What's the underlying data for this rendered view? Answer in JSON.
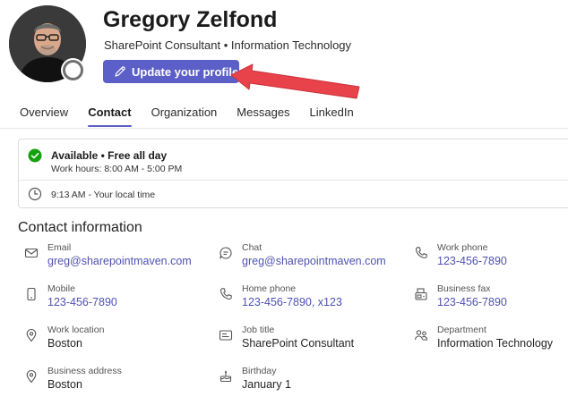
{
  "profile": {
    "name": "Gregory Zelfond",
    "subtitle": "SharePoint Consultant • Information Technology",
    "update_button": "Update your profile",
    "more": "."
  },
  "tabs": [
    {
      "label": "Overview",
      "active": false
    },
    {
      "label": "Contact",
      "active": true
    },
    {
      "label": "Organization",
      "active": false
    },
    {
      "label": "Messages",
      "active": false
    },
    {
      "label": "LinkedIn",
      "active": false
    }
  ],
  "status": {
    "title": "Available • Free all day",
    "work_hours": "Work hours: 8:00 AM - 5:00 PM",
    "local_time": "9:13 AM - Your local time"
  },
  "contact": {
    "section_title": "Contact information",
    "fields": [
      {
        "label": "Email",
        "value": "greg@sharepointmaven.com",
        "link": true,
        "icon": "mail-icon"
      },
      {
        "label": "Chat",
        "value": "greg@sharepointmaven.com",
        "link": true,
        "icon": "chat-icon"
      },
      {
        "label": "Work phone",
        "value": "123-456-7890",
        "link": true,
        "icon": "phone-icon"
      },
      {
        "label": "Mobile",
        "value": "123-456-7890",
        "link": true,
        "icon": "mobile-icon"
      },
      {
        "label": "Home phone",
        "value": "123-456-7890, x123",
        "link": true,
        "icon": "phone-icon"
      },
      {
        "label": "Business fax",
        "value": "123-456-7890",
        "link": true,
        "icon": "fax-icon"
      },
      {
        "label": "Work location",
        "value": "Boston",
        "link": false,
        "icon": "location-icon"
      },
      {
        "label": "Job title",
        "value": "SharePoint Consultant",
        "link": false,
        "icon": "id-card-icon"
      },
      {
        "label": "Department",
        "value": "Information Technology",
        "link": false,
        "icon": "people-icon"
      },
      {
        "label": "Business address",
        "value": "Boston",
        "link": false,
        "icon": "location-icon"
      },
      {
        "label": "Birthday",
        "value": "January 1",
        "link": false,
        "icon": "cake-icon"
      }
    ]
  },
  "colors": {
    "accent": "#5b5fc7",
    "link": "#4f52b2",
    "available": "#13a10e",
    "annotation_arrow": "#e8424b"
  }
}
